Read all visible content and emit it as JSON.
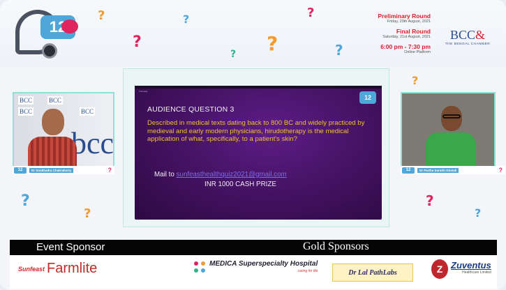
{
  "banner": {
    "anniversary_number": "12",
    "rounds": [
      {
        "title": "Preliminary Round",
        "date": "Friday, 20th August, 2021"
      },
      {
        "title": "Final Round",
        "date": "Saturday, 21st August, 2021"
      }
    ],
    "time": "6:00 pm - 7:30 pm",
    "platform": "Online Platform",
    "organizer": {
      "name": "BCC",
      "amp": "&",
      "subtitle": "THE BENGAL CHAMBER"
    }
  },
  "participants": [
    {
      "name": "Dr Soukhadra Chakraborty",
      "logo": "12",
      "mark": "?"
    },
    {
      "name": "Dr Partha Sarathi Ghatak",
      "logo": "12",
      "mark": "?"
    }
  ],
  "slide": {
    "top_label": "Thursday",
    "logo": "12",
    "heading": "AUDIENCE QUESTION 3",
    "question": "Described in medical texts dating back to 800 BC and widely practiced by medieval and early modern physicians, hirudotherapy is the medical application of what, specifically, to a patient's skin?",
    "mail_label": "Mail to",
    "mail_address": "sunfeasthealthquiz2021@gmail.com",
    "prize": "INR 1000 CASH PRIZE"
  },
  "wall_text": {
    "small": "BCC",
    "big": "bcc&"
  },
  "sponsors": {
    "event_label": "Event Sponsor",
    "gold_label": "Gold Sponsors",
    "event": {
      "mark": "Sunfeast",
      "name": "Farmlite"
    },
    "gold": [
      {
        "name": "MEDICA Superspecialty Hospital",
        "tagline": "caring for life"
      },
      {
        "name": "Dr Lal PathLabs"
      },
      {
        "name": "Zuventus",
        "tagline": "Healthcare Limited"
      }
    ]
  },
  "colors": {
    "accent_red": "#d6202f",
    "brand_blue": "#2a4d8f",
    "slide_purple": "#42115f",
    "question_yellow": "#f2c12e"
  }
}
